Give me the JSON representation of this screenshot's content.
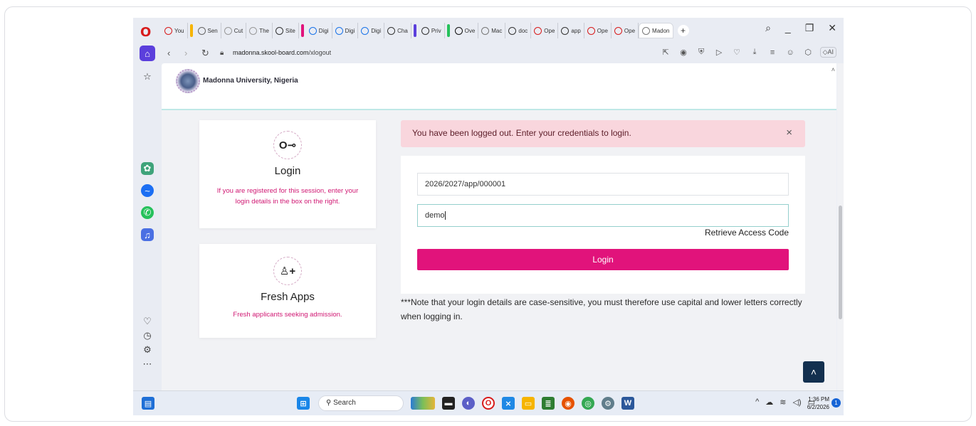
{
  "browser": {
    "tabs": [
      {
        "title": "You",
        "color": "#d81b1b"
      },
      {
        "title": "Sen",
        "color": "#666666"
      },
      {
        "title": "Cut",
        "color": "#999999"
      },
      {
        "title": "The",
        "color": "#999999"
      },
      {
        "title": "Site",
        "color": "#333333"
      },
      {
        "title": "Digi",
        "color": "#1a73e8"
      },
      {
        "title": "Digi",
        "color": "#1a73e8"
      },
      {
        "title": "Digi",
        "color": "#1a73e8"
      },
      {
        "title": "Cha",
        "color": "#333333"
      },
      {
        "title": "Priv",
        "color": "#333333"
      },
      {
        "title": "Ove",
        "color": "#111111"
      },
      {
        "title": "Mac",
        "color": "#777777"
      },
      {
        "title": "doc",
        "color": "#333333"
      },
      {
        "title": "Ope",
        "color": "#d81b1b"
      },
      {
        "title": "app",
        "color": "#333333"
      },
      {
        "title": "Ope",
        "color": "#d81b1b"
      },
      {
        "title": "Ope",
        "color": "#d81b1b"
      },
      {
        "title": "Madon",
        "color": "#777777"
      }
    ],
    "url_host": "madonna.skool-board.com",
    "url_path": "/xlogout"
  },
  "site": {
    "name": "Madonna University, Nigeria"
  },
  "login_card": {
    "title": "Login",
    "text": "If you are registered for this session, enter your login details in the box on the right."
  },
  "fresh_card": {
    "title": "Fresh Apps",
    "text": "Fresh applicants seeking admission."
  },
  "alert": {
    "message": "You have been logged out. Enter your credentials to login.",
    "close": "×"
  },
  "form": {
    "username_value": "2026/2027/app/000001",
    "password_value": "demo",
    "retrieve_label": "Retrieve Access Code",
    "login_label": "Login"
  },
  "note": "***Note that your login details are case-sensitive, you must therefore use capital and lower letters correctly when logging in.",
  "taskbar": {
    "search_label": "Search",
    "time": "1:36 PM",
    "date": "6/2/2026",
    "notif_count": "1"
  },
  "colors": {
    "accent": "#e1137b",
    "alert_bg": "#f9d6dd",
    "back_to_top": "#13304f"
  }
}
